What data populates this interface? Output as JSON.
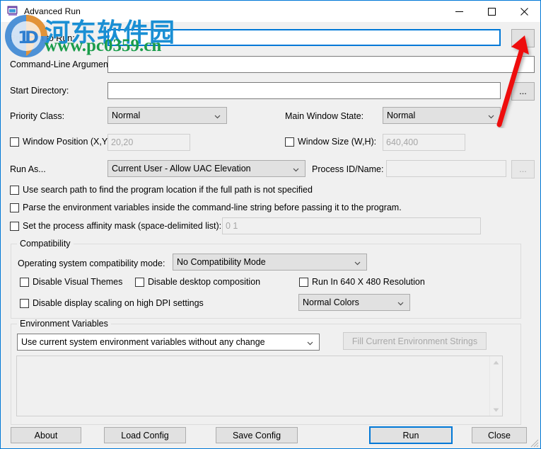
{
  "window": {
    "title": "Advanced Run",
    "icon": "app-window-icon",
    "accent_color": "#0078d7",
    "background_color": "#f0f0f0",
    "controls": {
      "minimize": "—",
      "maximize": "☐",
      "close": "✕"
    }
  },
  "watermark": {
    "chinese_text": "河东软件园",
    "url": "www.pc0359.cn",
    "chinese_color": "#1a8fd4",
    "url_color": "#1a9c4a"
  },
  "annotation": {
    "type": "red-arrow",
    "color": "#ee1111",
    "points_to": "program-to-run-browse-button"
  },
  "form": {
    "program_to_run": {
      "label": "Program to Run:",
      "value": "",
      "placeholder": "",
      "focused": true,
      "browse_label": "..."
    },
    "command_line_arguments": {
      "label": "Command-Line Arguments:",
      "value": "",
      "placeholder": ""
    },
    "start_directory": {
      "label": "Start Directory:",
      "value": "",
      "placeholder": "",
      "browse_label": "..."
    },
    "priority_class": {
      "label": "Priority Class:",
      "value": "Normal"
    },
    "main_window_state": {
      "label": "Main Window State:",
      "value": "Normal"
    },
    "window_position": {
      "label": "Window Position (X,Y):",
      "checked": false,
      "value": "",
      "placeholder": "20,20"
    },
    "window_size": {
      "label": "Window Size (W,H):",
      "checked": false,
      "value": "",
      "placeholder": "640,400"
    },
    "run_as": {
      "label": "Run As...",
      "value": "Current User - Allow UAC Elevation"
    },
    "process_id_name": {
      "label": "Process ID/Name:",
      "value": "",
      "placeholder": "",
      "disabled": true,
      "browse_label": "..."
    },
    "use_search_path": {
      "label": "Use search path to find the program location if the full path is not specified",
      "checked": false
    },
    "parse_env_vars": {
      "label": "Parse the environment variables inside the command-line string before passing it to the program.",
      "checked": false
    },
    "affinity_mask": {
      "label": "Set the process affinity mask (space-delimited list):",
      "checked": false,
      "value": "",
      "placeholder": "0 1"
    }
  },
  "compatibility": {
    "group_title": "Compatibility",
    "os_mode": {
      "label": "Operating system compatibility mode:",
      "value": "No Compatibility Mode"
    },
    "disable_visual_themes": {
      "label": "Disable Visual Themes",
      "checked": false
    },
    "disable_desktop_composition": {
      "label": "Disable desktop composition",
      "checked": false
    },
    "run_in_640x480": {
      "label": "Run In 640 X 480 Resolution",
      "checked": false
    },
    "disable_dpi_scaling": {
      "label": "Disable display scaling on high DPI settings",
      "checked": false
    },
    "colors": {
      "value": "Normal Colors"
    }
  },
  "environment_variables": {
    "group_title": "Environment Variables",
    "mode": {
      "value": "Use current system environment variables without any change"
    },
    "fill_button": {
      "label": "Fill Current Environment Strings",
      "disabled": true
    },
    "text_value": "",
    "scrollbar": {
      "up": "▲",
      "down": "▼"
    }
  },
  "footer": {
    "about": "About",
    "load_config": "Load Config",
    "save_config": "Save Config",
    "run": "Run",
    "close": "Close"
  }
}
